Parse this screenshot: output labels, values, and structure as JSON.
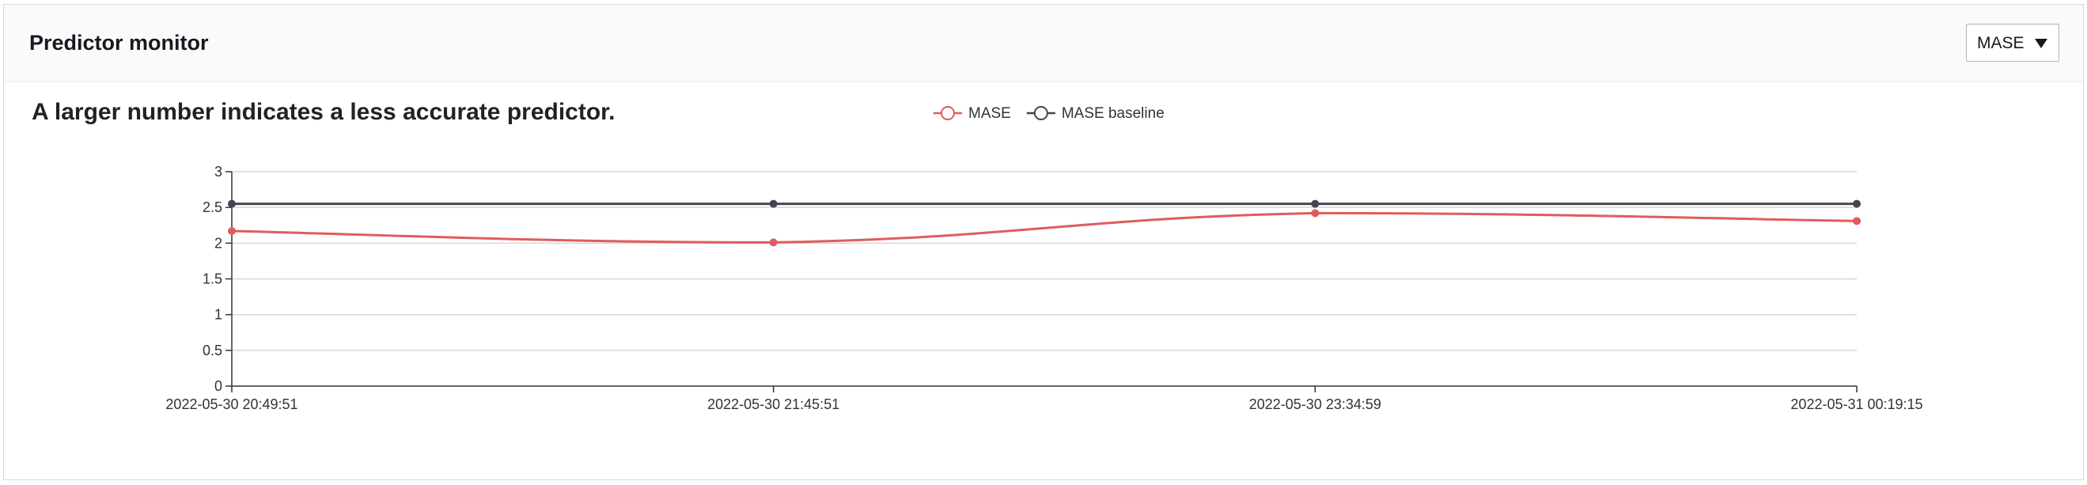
{
  "panel": {
    "title": "Predictor monitor",
    "metric_select": {
      "value": "MASE",
      "icon": "caret-down-icon"
    }
  },
  "subtitle": "A larger number indicates a less accurate predictor.",
  "chart_data": {
    "type": "line",
    "title": "",
    "xlabel": "",
    "ylabel": "",
    "categories": [
      "2022-05-30 20:49:51",
      "2022-05-30 21:45:51",
      "2022-05-30 23:34:59",
      "2022-05-31 00:19:15"
    ],
    "ylim": [
      0,
      3
    ],
    "yticks": [
      0,
      0.5,
      1,
      1.5,
      2,
      2.5,
      3
    ],
    "ytick_labels": [
      "0",
      "0.5",
      "1",
      "1.5",
      "2",
      "2.5",
      "3"
    ],
    "grid": true,
    "legend_position": "top-center",
    "series": [
      {
        "name": "MASE",
        "values": [
          2.17,
          2.01,
          2.42,
          2.31
        ],
        "color": "#e05c5c",
        "smooth": true
      },
      {
        "name": "MASE baseline",
        "values": [
          2.55,
          2.55,
          2.55,
          2.55
        ],
        "color": "#414750",
        "smooth": false
      }
    ]
  }
}
